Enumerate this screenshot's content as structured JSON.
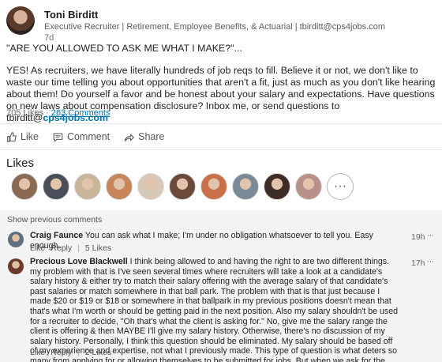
{
  "post": {
    "author": {
      "name": "Toni Birditt",
      "headline": "Executive Recruiter | Retirement, Employee Benefits, & Actuarial | tbirditt@cps4jobs.com",
      "time": "7d"
    },
    "body": {
      "headline": "\"ARE YOU ALLOWED TO ASK ME WHAT I MAKE?\"...",
      "paragraph": "YES! As recruiters, we have literally hundreds of job reqs to fill. Believe it or not, we don't like to waste our time telling you about opportunities that aren't a fit, just as much as you don't like hearing about them! Do yourself a favor and be honest about your salary and expectations. Have questions on new laws about compensation disclosure? Inbox me, or send questions to tbirditt@",
      "link": "cps4jobs.com"
    },
    "stats": {
      "likes": "705 Likes",
      "separator": "·",
      "comments": "263 Comments"
    }
  },
  "actions": {
    "like": "Like",
    "comment": "Comment",
    "share": "Share"
  },
  "likes_section": {
    "title": "Likes",
    "more": "···",
    "avatar_colors": [
      "#8a6a55",
      "#4a4e58",
      "#c9b59a",
      "#c8865a",
      "#d8c8b8",
      "#6b4a3a",
      "#c96f4a",
      "#7a8a96",
      "#3e2c26",
      "#b9918a"
    ]
  },
  "comments": {
    "show_previous": "Show previous comments",
    "items": [
      {
        "author": "Craig Faunce",
        "text": "You can ask what I make; I'm under no obligation whatsoever to tell you.   Easy enough.",
        "time": "19h",
        "more": "···",
        "like": "Like",
        "reply": "Reply",
        "likes": "5 Likes",
        "avatar_color": "#5f6f7d"
      },
      {
        "author": "Precious Love Blackwell",
        "text": "I think being allowed to and having the right to are two different things. my problem with that is I've seen several times where recruiters will take a look at a candidate's salary history & either try to match their salary offering with the average salary of that candidate's past salaries or match somewhere in that ball park. The problem with that is that just because I made $20 or $19 or $18 or somewhere in that ballpark in my previous positions doesn't mean that that's what I'm worth or should be getting paid in the next position. Also my salary shouldn't be used for a recruiter to decide, \"Oh that's what the client is asking for.\" No, give me the salary range the client is offering & then MAYBE I'll give my salary history. Otherwise, there's no discussion of my salary history. Personally, I think this question should be eliminated. My salary should be based off of my experience and expertise, not what I previously made. This type of question is what deters so many from applying for or allowing themselves to be submitted for jobs. But when we ask for the salary range for what a copy is offering, it's quiet.",
        "time": "17h",
        "more": "···",
        "like": "Like",
        "reply": "Reply",
        "likes": "2 Likes",
        "avatar_color": "#6b3a2c"
      }
    ]
  },
  "colors": {
    "link": "#0073b1",
    "comments_background": "#f3f3f3"
  }
}
